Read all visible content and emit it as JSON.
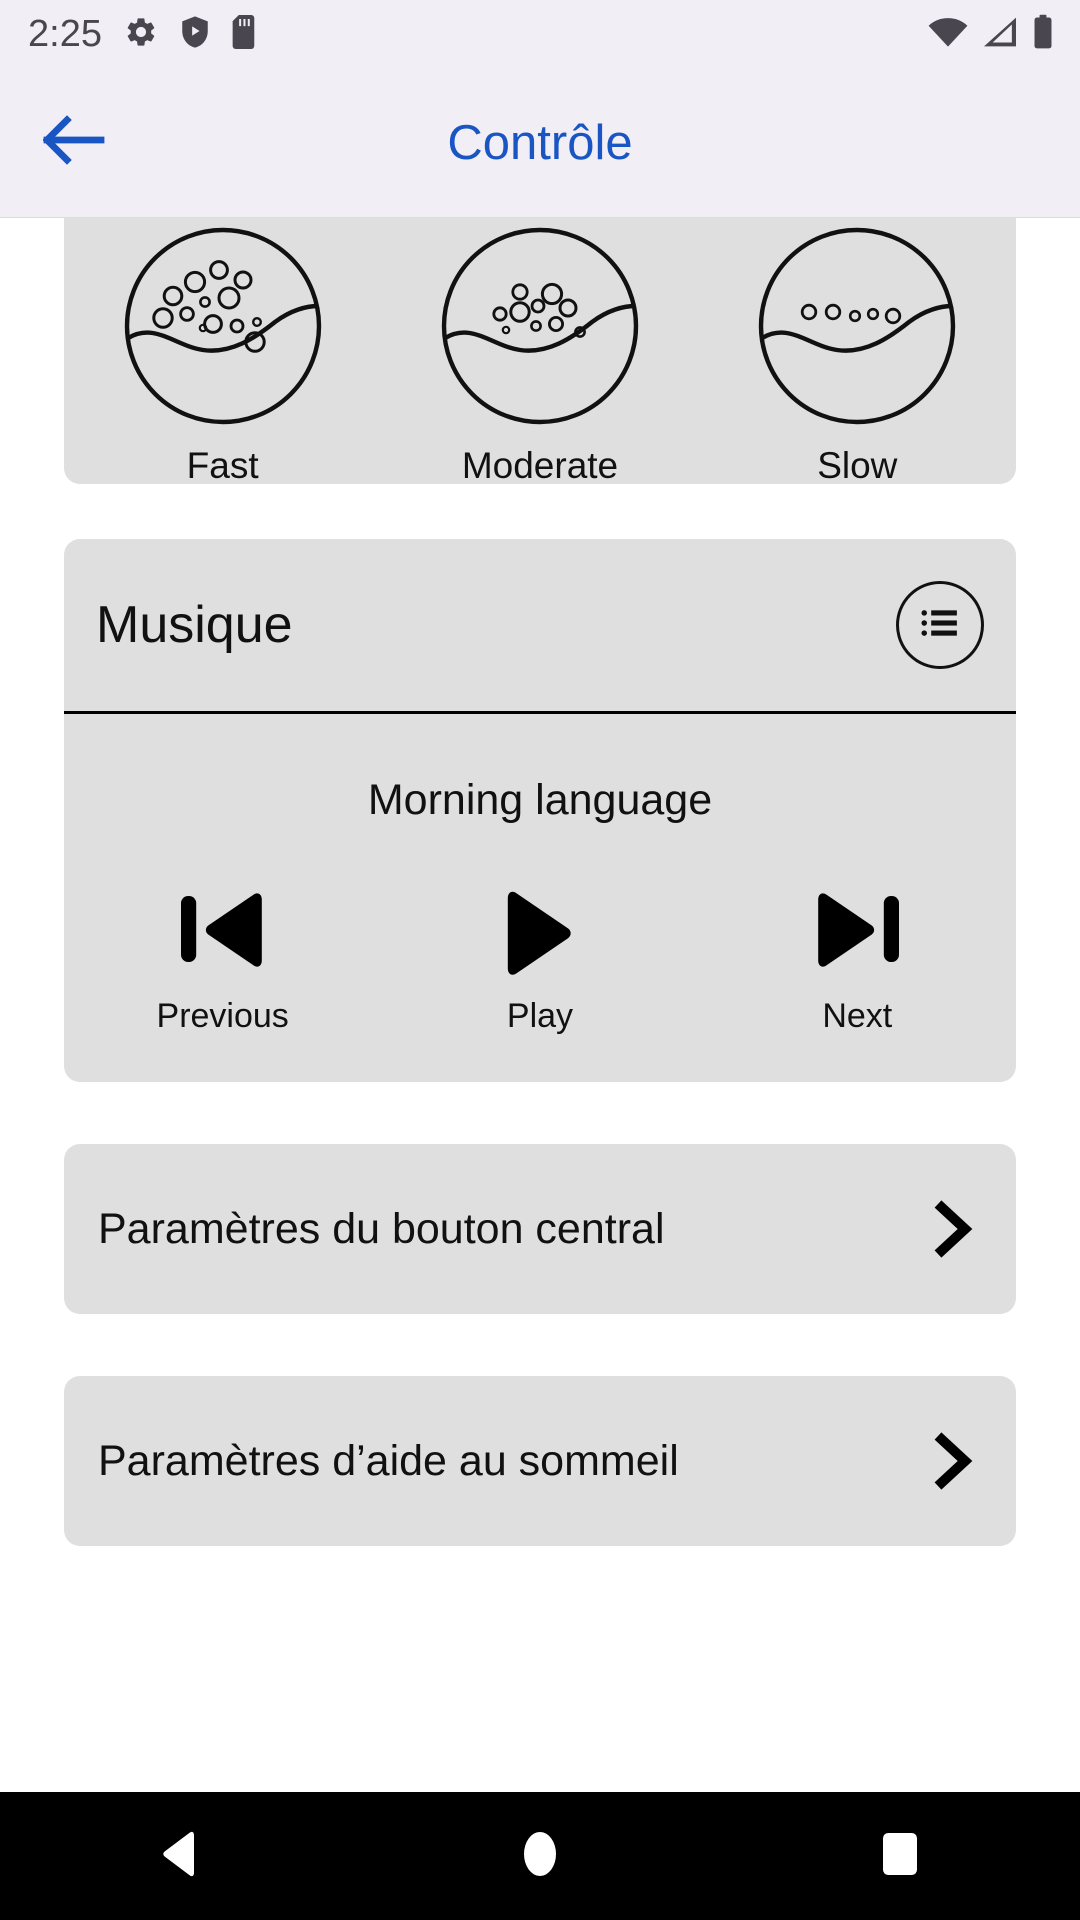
{
  "status_bar": {
    "time": "2:25",
    "left_icons": [
      "settings-gear-icon",
      "play-protect-shield-icon",
      "sd-card-icon"
    ],
    "right_icons": [
      "wifi-icon",
      "cellular-signal-icon",
      "battery-icon"
    ]
  },
  "app_bar": {
    "title": "Contrôle",
    "back_icon": "arrow-left-icon",
    "title_color": "#1a55c4",
    "background_color": "#f2eef5"
  },
  "intensity_card": {
    "options": [
      {
        "label": "Fast",
        "icon": "bubbles-fast-icon",
        "bubble_count": 14
      },
      {
        "label": "Moderate",
        "icon": "bubbles-moderate-icon",
        "bubble_count": 10
      },
      {
        "label": "Slow",
        "icon": "bubbles-slow-icon",
        "bubble_count": 5
      }
    ]
  },
  "music_card": {
    "title": "Musique",
    "playlist_icon": "playlist-list-icon",
    "track_title": "Morning language",
    "controls": [
      {
        "label": "Previous",
        "icon": "skip-previous-icon"
      },
      {
        "label": "Play",
        "icon": "play-icon"
      },
      {
        "label": "Next",
        "icon": "skip-next-icon"
      }
    ]
  },
  "settings_rows": [
    {
      "label": "Paramètres du bouton central",
      "icon": "chevron-right-icon"
    },
    {
      "label": "Paramètres d’aide au sommeil",
      "icon": "chevron-right-icon"
    }
  ],
  "nav_bar": {
    "buttons": [
      {
        "name": "back",
        "icon": "nav-back-triangle-icon"
      },
      {
        "name": "home",
        "icon": "nav-home-circle-icon"
      },
      {
        "name": "recents",
        "icon": "nav-recents-square-icon"
      }
    ]
  },
  "colors": {
    "card_bg": "#dfdfdf",
    "page_bg": "#ffffff",
    "appbar_bg": "#f2eef5",
    "accent": "#1a55c4",
    "nav_bg": "#000000"
  }
}
